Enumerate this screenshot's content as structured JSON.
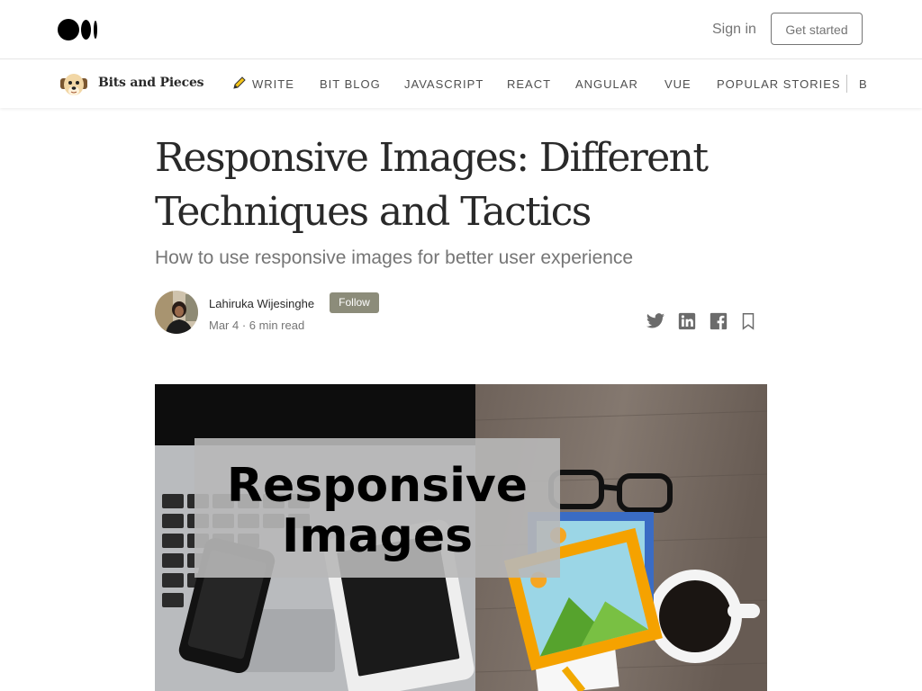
{
  "topbar": {
    "logo_icon": "medium-logo-icon",
    "signin_label": "Sign in",
    "get_started_label": "Get started"
  },
  "publication": {
    "logo_icon": "dog-mascot-icon",
    "name": "Bits and Pieces",
    "nav": [
      {
        "label": "WRITE",
        "icon": "pencil-icon"
      },
      {
        "label": "BIT BLOG"
      },
      {
        "label": "JAVASCRIPT"
      },
      {
        "label": "REACT"
      },
      {
        "label": "ANGULAR"
      },
      {
        "label": "VUE"
      },
      {
        "label": "POPULAR STORIES"
      }
    ],
    "nav_overflow_label": "B"
  },
  "article": {
    "title": "Responsive Images: Different Techniques and Tactics",
    "subtitle": "How to use responsive images for better user experience",
    "author_name": "Lahiruka Wijesinghe",
    "follow_label": "Follow",
    "meta": "Mar 4 · 6 min read",
    "share_icons": [
      "twitter-icon",
      "linkedin-icon",
      "facebook-icon",
      "bookmark-icon"
    ],
    "hero": {
      "text_line1": "Responsive",
      "text_line2": "Images"
    }
  },
  "colors": {
    "follow_bg": "#8c8c7a",
    "text_primary": "#292929",
    "text_muted": "#757575",
    "border": "#e6e6e6"
  }
}
